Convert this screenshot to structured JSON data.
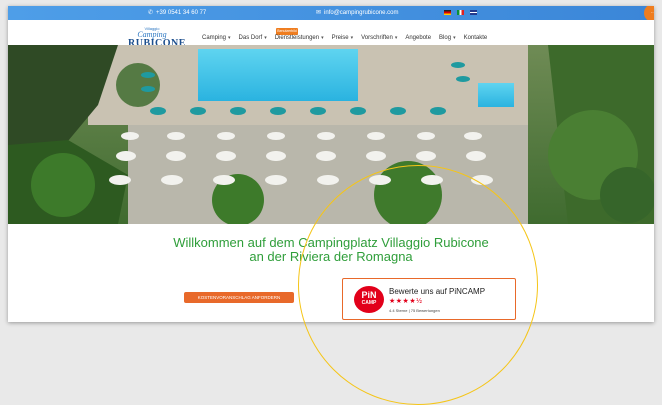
{
  "topbar": {
    "phone": "+39 0541 34 60 77",
    "email": "info@campingrubicone.com",
    "phone_icon": "phone-icon",
    "email_icon": "mail-icon",
    "languages": [
      "de",
      "it",
      "gb"
    ]
  },
  "logo": {
    "line1": "Villaggio",
    "line2": "Camping",
    "line3": "RUBICONE"
  },
  "nav": {
    "items": [
      "Camping",
      "Das Dorf",
      "Dienstleistungen",
      "Preise",
      "Vorschriften",
      "Angebote",
      "Blog",
      "Kontakte"
    ],
    "badge": "Benutzerbild"
  },
  "hero": {
    "headline_line1": "Willkommen auf dem Campingplatz Villaggio Rubicone",
    "headline_line2": "an der Riviera der Romagna"
  },
  "cta": {
    "label": "KOSTENVORANSCHLAG ANFORDERN"
  },
  "pincamp": {
    "logo_top": "PiN",
    "logo_bottom": "CAMP",
    "title": "Bewerte uns auf PiNCAMP",
    "stars": "★★★★½",
    "rating_text": "4.4 Sterne | 75 Bewertungen"
  },
  "colors": {
    "accent_blue": "#3b86d8",
    "headline_green": "#2f9e3a",
    "cta_orange": "#e8692a",
    "pincamp_red": "#e2001a",
    "annotation_yellow": "#f5c518"
  }
}
